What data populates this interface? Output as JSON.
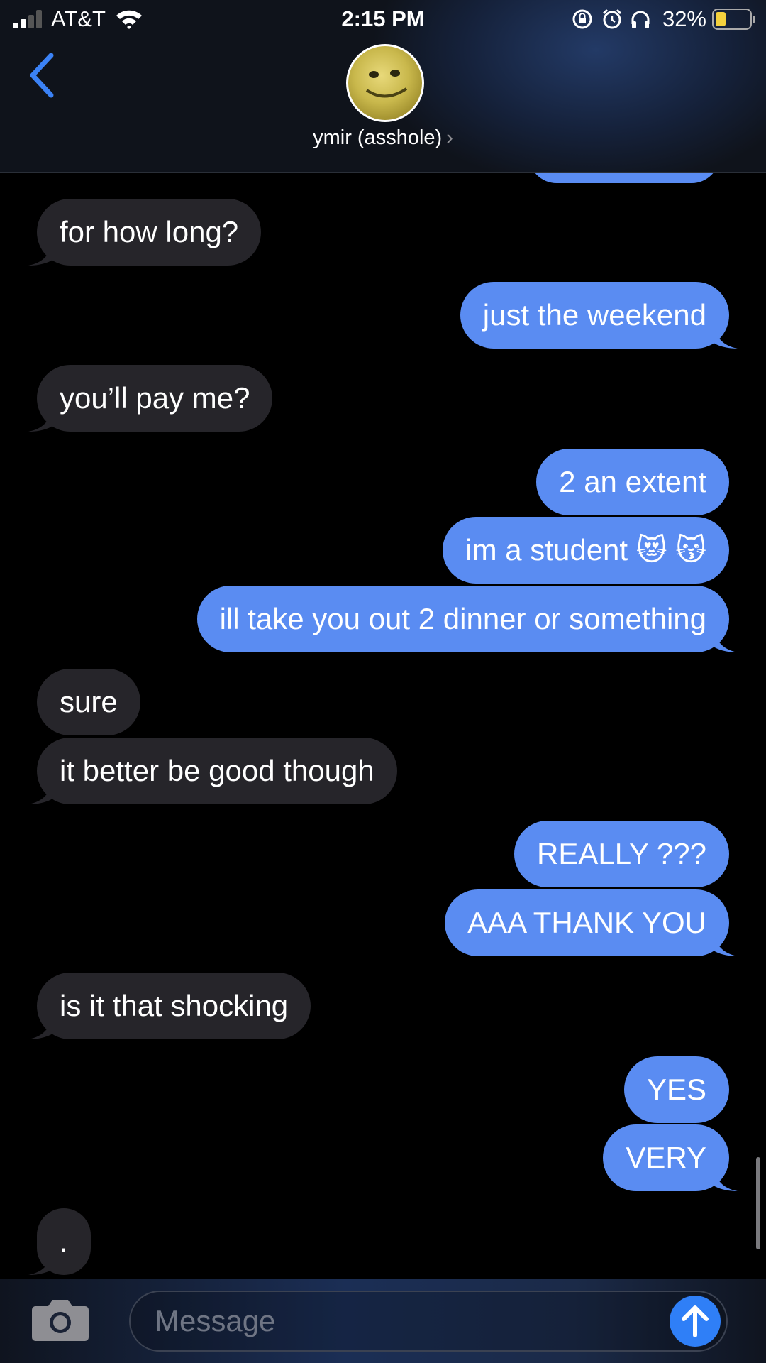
{
  "status_bar": {
    "carrier": "AT&T",
    "time": "2:15 PM",
    "battery_percent": "32%",
    "icons": [
      "signal-icon",
      "wifi-icon",
      "rotation-lock-icon",
      "alarm-icon",
      "headphones-icon",
      "battery-icon"
    ]
  },
  "header": {
    "back_icon": "chevron-left-icon",
    "contact_name": "ymir (asshole)",
    "contact_chevron": "›"
  },
  "messages": [
    {
      "id": 1,
      "direction": "received",
      "text": "for how long?"
    },
    {
      "id": 2,
      "direction": "sent",
      "text": "just the weekend"
    },
    {
      "id": 3,
      "direction": "received",
      "text": "you’ll pay me?"
    },
    {
      "id": 4,
      "direction": "sent",
      "text": "2 an extent"
    },
    {
      "id": 5,
      "direction": "sent",
      "text": "im a student 😻 😽"
    },
    {
      "id": 6,
      "direction": "sent",
      "text": "ill take you out 2 dinner or something"
    },
    {
      "id": 7,
      "direction": "received",
      "text": "sure"
    },
    {
      "id": 8,
      "direction": "received",
      "text": "it better be good though"
    },
    {
      "id": 9,
      "direction": "sent",
      "text": "REALLY ???"
    },
    {
      "id": 10,
      "direction": "sent",
      "text": "AAA THANK YOU"
    },
    {
      "id": 11,
      "direction": "received",
      "text": "is it that shocking"
    },
    {
      "id": 12,
      "direction": "sent",
      "text": "YES"
    },
    {
      "id": 13,
      "direction": "sent",
      "text": "VERY"
    },
    {
      "id": 14,
      "direction": "received",
      "text": "."
    }
  ],
  "composer": {
    "placeholder": "Message",
    "camera_icon": "camera-icon",
    "send_icon": "send-arrow-icon"
  },
  "colors": {
    "sent_bubble": "#5a8cf2",
    "received_bubble": "#26252a",
    "accent": "#2f7ff7",
    "background": "#000000"
  }
}
